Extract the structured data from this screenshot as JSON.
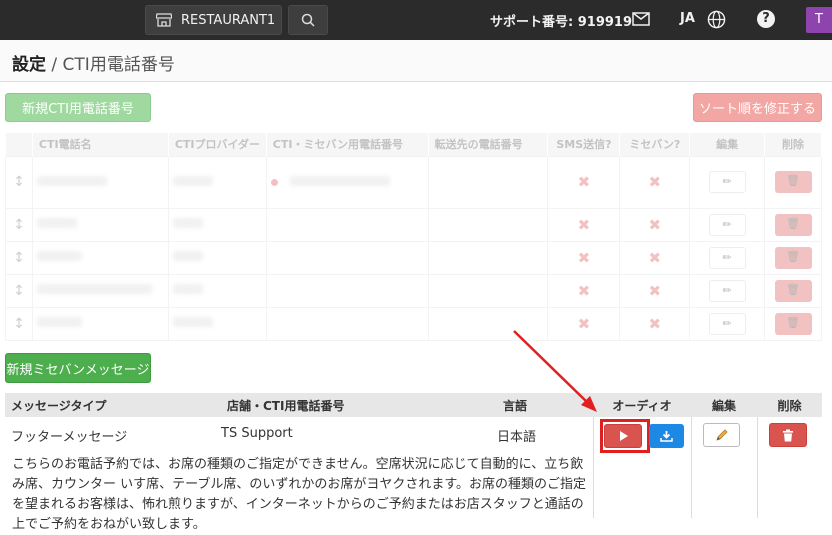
{
  "topbar": {
    "store_name": "RESTAURANT1",
    "support_label": "サポート番号: 919919",
    "language": "JA",
    "help": "?",
    "avatar_initial": "T",
    "icons": [
      "store-icon",
      "search-icon",
      "mail-icon",
      "globe-icon",
      "help-icon"
    ]
  },
  "page": {
    "title_main": "設定",
    "title_sep": " / ",
    "title_sub": "CTI用電話番号"
  },
  "buttons": {
    "new_cti": "新規CTI用電話番号",
    "fix_sort": "ソート順を修正する",
    "new_message": "新規ミセバンメッセージ"
  },
  "cti_table": {
    "headers": [
      "CTI電話名",
      "CTIプロバイダー",
      "CTI・ミセバン用電話番号",
      "転送先の電話番号",
      "SMS送信?",
      "ミセバン?",
      "編集",
      "削除"
    ],
    "row_count": 5,
    "sms_mark": "✖",
    "misebang_mark": "✖"
  },
  "message_table": {
    "headers": [
      "メッセージタイプ",
      "店舗・CTI用電話番号",
      "言語",
      "オーディオ",
      "編集",
      "削除"
    ],
    "row": {
      "type": "フッターメッセージ",
      "store": "TS Support",
      "language": "日本語",
      "body": "こちらのお電話予約では、お席の種類のご指定ができません。空席状況に応じて自動的に、立ち飲み席、カウンター いす席、テーブル席、のいずれかのお席がヨヤクされます。お席の種類のご指定を望まれるお客様は、怖れ煎りますが、インターネットからのご予約またはお店スタッフと通話の上でご予約をおねがい致します。"
    }
  },
  "colors": {
    "topbar": "#2b2b2b",
    "green": "#4cae4c",
    "red": "#d9534f",
    "blue": "#1e88e5",
    "highlight": "#e02020"
  }
}
